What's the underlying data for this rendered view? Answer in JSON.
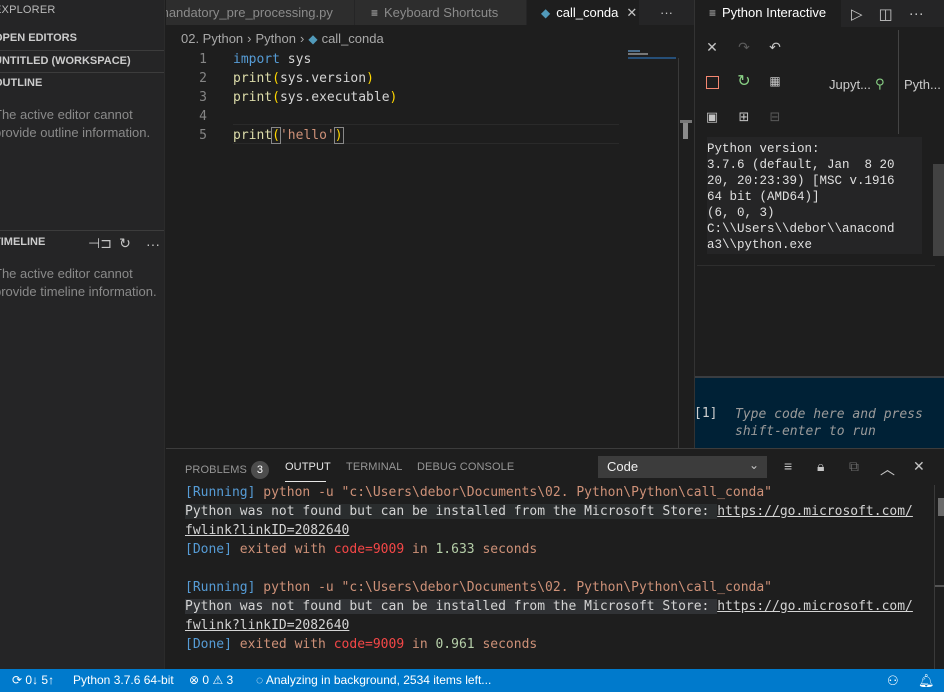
{
  "sidebar": {
    "title": "EXPLORER",
    "sections": {
      "open_editors": "OPEN EDITORS",
      "workspace": "UNTITLED (WORKSPACE)",
      "outline": "OUTLINE",
      "outline_msg": "The active editor cannot provide outline information.",
      "timeline": "TIMELINE",
      "timeline_msg": "The active editor cannot provide timeline information."
    }
  },
  "tabs": [
    {
      "label": "mandatory_pre_processing.py",
      "active": false
    },
    {
      "label": "Keyboard Shortcuts",
      "active": false
    },
    {
      "label": "call_conda",
      "active": true
    }
  ],
  "tab_more": "···",
  "breadcrumb": [
    "02. Python",
    "Python",
    "call_conda"
  ],
  "editor": {
    "line_numbers": [
      "1",
      "2",
      "3",
      "4",
      "5"
    ],
    "lines": {
      "l1_kw": "import",
      "l1_rest": " sys",
      "l2_fn": "print",
      "l2_open": "(",
      "l2_arg": "sys.version",
      "l2_close": ")",
      "l3_fn": "print",
      "l3_open": "(",
      "l3_arg": "sys.executable",
      "l3_close": ")",
      "l5_fn": "print",
      "l5_open": "(",
      "l5_str": "'hello'",
      "l5_close": ")"
    }
  },
  "interactive": {
    "tab_label": "Python Interactive",
    "kernel_label": "Jupyt...",
    "interpreter_label": "Pyth...",
    "output": "Python version:\n3.7.6 (default, Jan  8 20\n20, 20:23:39) [MSC v.1916\n64 bit (AMD64)]\n(6, 0, 3)\nC:\\\\Users\\\\debor\\\\anacond\na3\\\\python.exe",
    "prompt": "[1]",
    "placeholder_line1": "Type code here and press",
    "placeholder_line2": "shift-enter to run"
  },
  "panel": {
    "tabs": {
      "problems": "PROBLEMS",
      "problems_count": "3",
      "output": "OUTPUT",
      "terminal": "TERMINAL",
      "debug": "DEBUG CONSOLE"
    },
    "select_value": "Code",
    "runs": [
      {
        "running_tag": "[Running]",
        "command": " python -u \"c:\\Users\\debor\\Documents\\02. Python\\Python\\call_conda\"",
        "message": "Python was not found but can be installed from the Microsoft Store: ",
        "link1": "https://go.microsoft.com/",
        "link2": "fwlink?linkID=2082640",
        "done_tag": "[Done]",
        "exited": " exited with ",
        "code": "code=9009",
        "in": " in ",
        "time": "1.633",
        "seconds": " seconds"
      },
      {
        "running_tag": "[Running]",
        "command": " python -u \"c:\\Users\\debor\\Documents\\02. Python\\Python\\call_conda\"",
        "message": "Python was not found but can be installed from the Microsoft Store: ",
        "link1": "https://go.microsoft.com/",
        "link2": "fwlink?linkID=2082640",
        "done_tag": "[Done]",
        "exited": " exited with ",
        "code": "code=9009",
        "in": " in ",
        "time": "0.961",
        "seconds": " seconds"
      }
    ]
  },
  "status": {
    "sync": "0↓ 5↑",
    "interpreter": "Python 3.7.6 64-bit",
    "errors": "0",
    "warnings": "3",
    "analyzing": "Analyzing in background, 2534 items left..."
  },
  "colors": {
    "status_bar": "#007acc",
    "accent_blue": "#569cd6",
    "string": "#ce9178",
    "error_red": "#f44747"
  }
}
